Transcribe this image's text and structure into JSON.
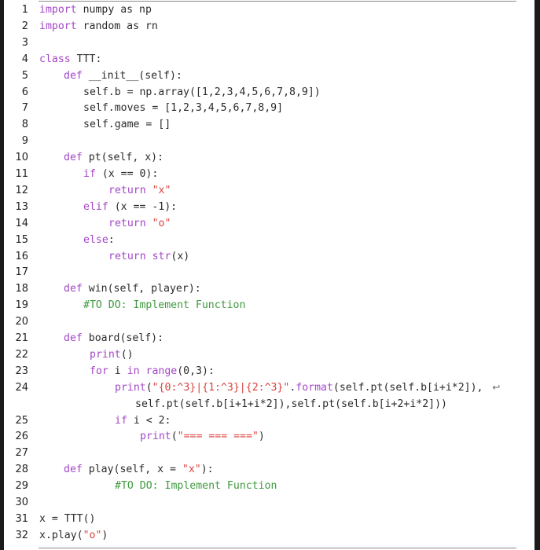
{
  "listing": {
    "lines": [
      {
        "n": "1",
        "indent": 50,
        "parts": [
          [
            "kw",
            "import"
          ],
          [
            "",
            "numpy as np"
          ]
        ],
        "sep": " "
      },
      {
        "n": "2",
        "indent": 50,
        "parts": [
          [
            "kw",
            "import"
          ],
          [
            "",
            "random as rn"
          ]
        ],
        "sep": " "
      },
      {
        "n": "3",
        "indent": 50,
        "parts": []
      },
      {
        "n": "4",
        "indent": 50,
        "parts": [
          [
            "kw",
            "class"
          ],
          [
            "",
            "TTT:"
          ]
        ],
        "sep": " "
      },
      {
        "n": "5",
        "indent": 81,
        "parts": [
          [
            "kw",
            "def"
          ],
          [
            "",
            "__init__(self):"
          ]
        ],
        "sep": " "
      },
      {
        "n": "6",
        "indent": 106,
        "parts": [
          [
            "",
            "self.b = np.array([1,2,3,4,5,6,7,8,9])"
          ]
        ]
      },
      {
        "n": "7",
        "indent": 106,
        "parts": [
          [
            "",
            "self.moves = [1,2,3,4,5,6,7,8,9]"
          ]
        ]
      },
      {
        "n": "8",
        "indent": 106,
        "parts": [
          [
            "",
            "self.game = []"
          ]
        ]
      },
      {
        "n": "9",
        "indent": 50,
        "parts": []
      },
      {
        "n": "10",
        "indent": 81,
        "parts": [
          [
            "kw",
            "def"
          ],
          [
            "",
            "pt(self, x):"
          ]
        ],
        "sep": " "
      },
      {
        "n": "11",
        "indent": 106,
        "parts": [
          [
            "kw",
            "if"
          ],
          [
            "",
            " (x == 0):"
          ]
        ]
      },
      {
        "n": "12",
        "indent": 138,
        "parts": [
          [
            "kw",
            "return"
          ],
          [
            "",
            " "
          ],
          [
            "str",
            "\"x\""
          ]
        ]
      },
      {
        "n": "13",
        "indent": 106,
        "parts": [
          [
            "kw",
            "elif"
          ],
          [
            "",
            " (x == -1):"
          ]
        ]
      },
      {
        "n": "14",
        "indent": 138,
        "parts": [
          [
            "kw",
            "return"
          ],
          [
            "",
            " "
          ],
          [
            "str",
            "\"o\""
          ]
        ]
      },
      {
        "n": "15",
        "indent": 106,
        "parts": [
          [
            "kw",
            "else"
          ],
          [
            "",
            ":"
          ]
        ]
      },
      {
        "n": "16",
        "indent": 138,
        "parts": [
          [
            "kw",
            "return"
          ],
          [
            "",
            " "
          ],
          [
            "kw",
            "str"
          ],
          [
            "",
            "(x)"
          ]
        ]
      },
      {
        "n": "17",
        "indent": 50,
        "parts": []
      },
      {
        "n": "18",
        "indent": 81,
        "parts": [
          [
            "kw",
            "def"
          ],
          [
            "",
            "win(self, player):"
          ]
        ],
        "sep": " "
      },
      {
        "n": "19",
        "indent": 106,
        "parts": [
          [
            "cm",
            "#TO DO: Implement Function"
          ]
        ]
      },
      {
        "n": "20",
        "indent": 50,
        "parts": []
      },
      {
        "n": "21",
        "indent": 81,
        "parts": [
          [
            "kw",
            "def"
          ],
          [
            "",
            "board(self):"
          ]
        ],
        "sep": " "
      },
      {
        "n": "22",
        "indent": 114,
        "parts": [
          [
            "kw",
            "print"
          ],
          [
            "",
            "()"
          ]
        ]
      },
      {
        "n": "23",
        "indent": 114,
        "parts": [
          [
            "kw",
            "for"
          ],
          [
            "",
            " i "
          ],
          [
            "kw",
            "in"
          ],
          [
            "",
            " "
          ],
          [
            "kw",
            "range"
          ],
          [
            "",
            "(0,3):"
          ]
        ]
      },
      {
        "n": "24",
        "indent": 146,
        "parts": [
          [
            "kw",
            "print"
          ],
          [
            "",
            "("
          ],
          [
            "str",
            "\"{0:^3}|{1:^3}|{2:^3}\""
          ],
          [
            "",
            "."
          ],
          [
            "kw",
            "format"
          ],
          [
            "",
            "(self.pt(self.b[i+i*2]), "
          ]
        ],
        "wrap": "↩"
      },
      {
        "n": "",
        "indent": 172,
        "parts": [
          [
            "",
            "self.pt(self.b[i+1+i*2]),self.pt(self.b[i+2+i*2]))"
          ]
        ]
      },
      {
        "n": "25",
        "indent": 146,
        "parts": [
          [
            "kw",
            "if"
          ],
          [
            "",
            " i < 2:"
          ]
        ]
      },
      {
        "n": "26",
        "indent": 178,
        "parts": [
          [
            "kw",
            "print"
          ],
          [
            "",
            "("
          ],
          [
            "str",
            "\"=== === ===\""
          ],
          [
            "",
            ")"
          ]
        ]
      },
      {
        "n": "27",
        "indent": 50,
        "parts": []
      },
      {
        "n": "28",
        "indent": 81,
        "parts": [
          [
            "kw",
            "def"
          ],
          [
            "",
            "play(self, x = "
          ],
          [
            "str",
            "\"x\""
          ],
          [
            "",
            "):"
          ]
        ],
        "sep": " "
      },
      {
        "n": "29",
        "indent": 146,
        "parts": [
          [
            "cm",
            "#TO DO: Implement Function"
          ]
        ]
      },
      {
        "n": "30",
        "indent": 50,
        "parts": []
      },
      {
        "n": "31",
        "indent": 50,
        "parts": [
          [
            "",
            "x = TTT()"
          ]
        ]
      },
      {
        "n": "32",
        "indent": 50,
        "parts": [
          [
            "",
            "x.play("
          ],
          [
            "str",
            "\"o\""
          ],
          [
            "",
            ")"
          ]
        ]
      }
    ]
  },
  "colors": {
    "keyword": "#a347c7",
    "string": "#d9433f",
    "comment": "#3f9a3f",
    "text": "#2b2b2b"
  }
}
